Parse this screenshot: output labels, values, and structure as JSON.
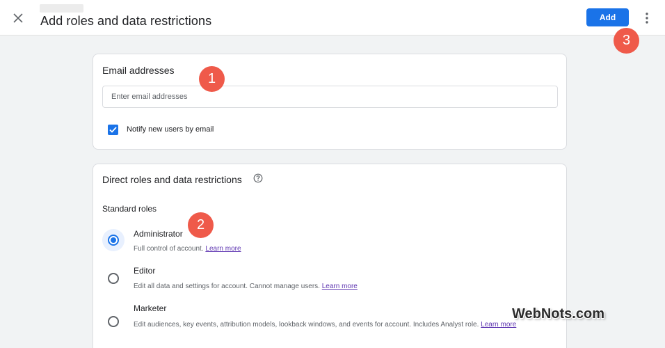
{
  "header": {
    "title": "Add roles and data restrictions",
    "add_label": "Add"
  },
  "email_card": {
    "heading": "Email addresses",
    "input_placeholder": "Enter email addresses",
    "input_value": "",
    "notify_label": "Notify new users by email",
    "notify_checked": true
  },
  "roles_card": {
    "heading": "Direct roles and data restrictions",
    "subheading": "Standard roles",
    "roles": [
      {
        "title": "Administrator",
        "desc": "Full control of account.",
        "link": "Learn more",
        "selected": true
      },
      {
        "title": "Editor",
        "desc": "Edit all data and settings for account. Cannot manage users.",
        "link": "Learn more",
        "selected": false
      },
      {
        "title": "Marketer",
        "desc": "Edit audiences, key events, attribution models, lookback windows, and events for account. Includes Analyst role.",
        "link": "Learn more",
        "selected": false
      }
    ]
  },
  "annotations": {
    "step1": "1",
    "step2": "2",
    "step3": "3"
  },
  "watermark": "WebNots.com",
  "colors": {
    "primary": "#1a73e8",
    "badge": "#ef5a4a",
    "link": "#5e35b1"
  }
}
